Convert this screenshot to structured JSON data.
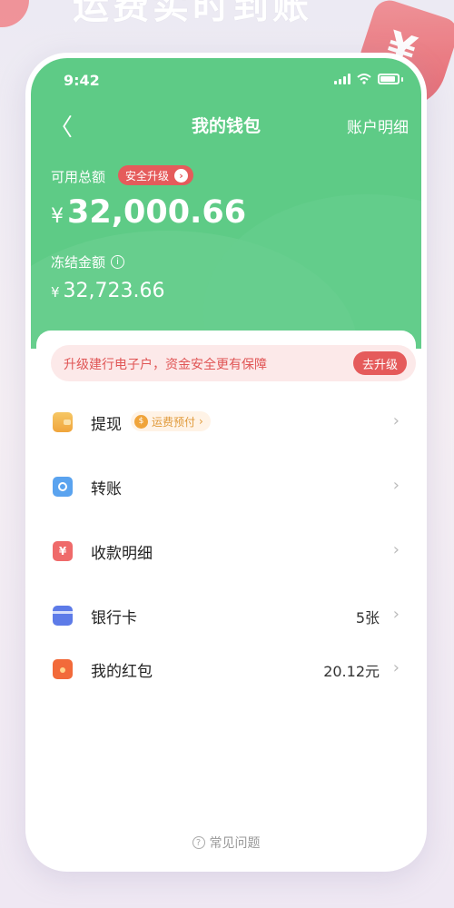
{
  "backdrop": {
    "headline": "运费实时到账",
    "shield_glyph": "¥"
  },
  "status_bar": {
    "time": "9:42"
  },
  "nav": {
    "back_glyph": "〈",
    "title": "我的钱包",
    "right_label": "账户明细"
  },
  "balance": {
    "available_label": "可用总额",
    "security_badge": "安全升级",
    "badge_arrow": "›",
    "currency": "¥",
    "available_amount": "32,000.66",
    "frozen_label": "冻结金额",
    "info_glyph": "i",
    "frozen_amount": "32,723.66"
  },
  "banner": {
    "text": "升级建行电子户，资金安全更有保障",
    "button": "去升级"
  },
  "menu": {
    "withdraw": {
      "label": "提现",
      "tag": "运费预付",
      "tag_icon": "$",
      "tag_arrow": "›"
    },
    "transfer": {
      "label": "转账"
    },
    "receipts": {
      "label": "收款明细",
      "icon_glyph": "¥"
    },
    "bank_cards": {
      "label": "银行卡",
      "value": "5张"
    },
    "red_packets": {
      "label": "我的红包",
      "value": "20.12元"
    },
    "chevron": "›"
  },
  "footer": {
    "faq_label": "常见问题",
    "faq_icon": "?"
  },
  "colors": {
    "primary_green": "#5ecb86",
    "accent_red": "#e55b5b",
    "banner_bg": "#fce9e9",
    "freight_orange": "#f0a43a"
  }
}
